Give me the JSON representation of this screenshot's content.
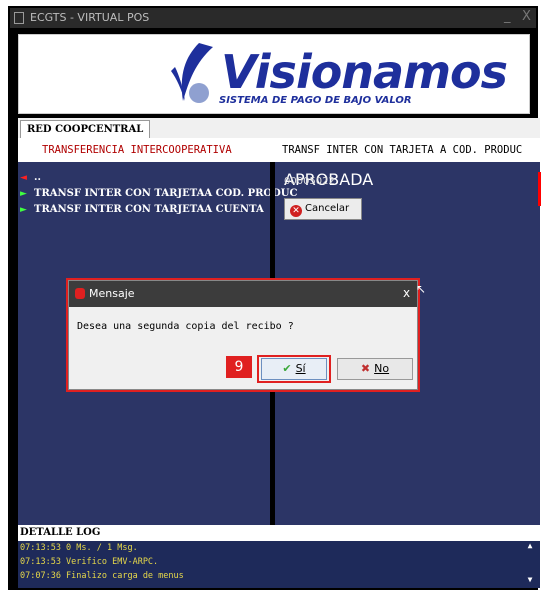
{
  "window": {
    "title": "ECGTS - VIRTUAL POS",
    "minimize": "_",
    "close": "X"
  },
  "banner": {
    "brand": "Visionamos",
    "tagline": "SISTEMA DE PAGO DE BAJO VALOR"
  },
  "tabs": [
    {
      "label": "RED COOPCENTRAL"
    }
  ],
  "columns": {
    "left": "TRANSFERENCIA INTERCOOPERATIVA",
    "right": "TRANSF INTER CON TARJETA A COD. PRODUC"
  },
  "menu": {
    "back_label": "..",
    "items": [
      {
        "label": "TRANSF INTER CON TARJETAA COD. PRODUC"
      },
      {
        "label": "TRANSF INTER CON TARJETAA CUENTA"
      }
    ]
  },
  "right_panel": {
    "status": "APROBADA",
    "approval_code": "00005022",
    "cancel_label": "Cancelar"
  },
  "dialog": {
    "title": "Mensaje",
    "close": "x",
    "message": "Desea una segunda copia del recibo ?",
    "yes_label": "Sí",
    "no_label": "No"
  },
  "annotation": {
    "step": "9"
  },
  "log": {
    "header": "DETALLE LOG",
    "lines": [
      "07:13:53 0 Ms. / 1 Msg.",
      "07:13:53 Verifico EMV-ARPC.",
      "07:07:36 Finalizo carga de menus"
    ]
  },
  "colors": {
    "panel_bg": "#2c3566",
    "log_bg": "#1e2a5a",
    "log_text": "#e6d84a",
    "highlight": "#e02020",
    "brand": "#1e2f9c"
  },
  "icons": [
    "app-icon",
    "back-arrow-icon",
    "go-arrow-icon",
    "cancel-icon",
    "stop-icon",
    "check-icon",
    "x-icon",
    "scroll-up-icon",
    "scroll-down-icon"
  ]
}
